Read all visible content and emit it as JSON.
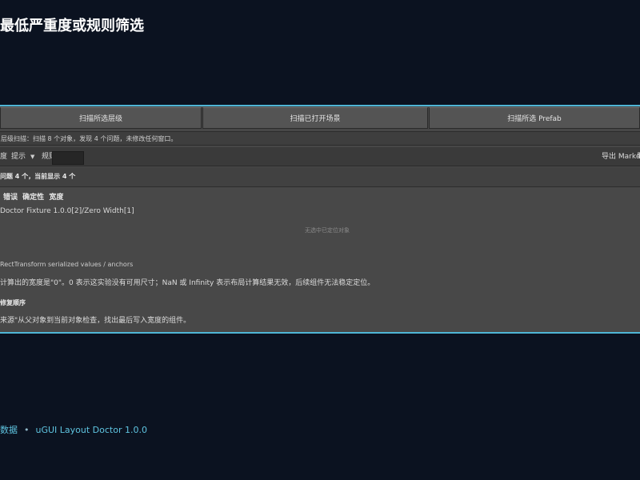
{
  "page": {
    "title": "最低严重度或规则筛选"
  },
  "toolbar": {
    "scan_hierarchy": "扫描所选层级",
    "scan_open_scenes": "扫描已打开场景",
    "scan_prefab": "扫描所选 Prefab"
  },
  "status": {
    "text": "层级扫描：扫描 8 个对象，发现 4 个问题，未修改任何窗口。"
  },
  "filter": {
    "severity_label": "度",
    "severity_value": "提示",
    "rule_label": "规则",
    "rule_value": "",
    "export_markdown": "导出 Markdown",
    "export_more": "导"
  },
  "summary": {
    "count_text": "问题 4 个，当前显示 4 个"
  },
  "result": {
    "tags": [
      "错误",
      "确定性",
      "宽度"
    ],
    "object": "Doctor Fixture 1.0.0[2]/Zero Width[1]",
    "hint": "无选中已定位对象",
    "path": "RectTransform serialized values / anchors",
    "description": "计算出的宽度是\"0\"。0 表示这实验没有可用尺寸；NaN 或 Infinity 表示布局计算结果无效，后续组件无法稳定定位。",
    "section_title": "修复顺序",
    "source": "来源\"从父对象到当前对象检查，找出最后写入宽度的组件。"
  },
  "footer": {
    "left": "数据",
    "right": "uGUI Layout Doctor 1.0.0"
  }
}
